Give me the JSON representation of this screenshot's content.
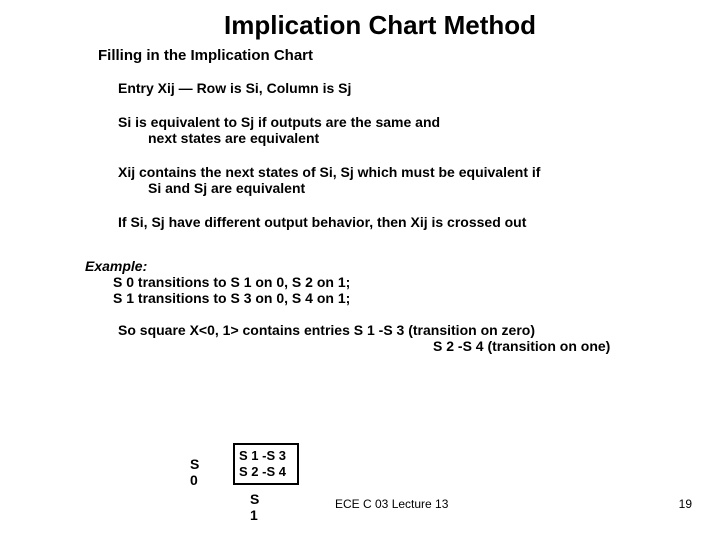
{
  "title": "Implication Chart Method",
  "subtitle": "Filling in the Implication Chart",
  "entry": "Entry Xij — Row is Si, Column is Sj",
  "para1_line1": "Si is equivalent to Sj if outputs are the same and",
  "para1_line2": "next states are equivalent",
  "para2_line1": "Xij contains the next states of Si, Sj which must be equivalent if",
  "para2_line2": "Si and Sj are equivalent",
  "para3": "If Si, Sj have different output behavior, then Xij is crossed out",
  "example_head": "Example:",
  "example_l1": "S 0 transitions to S 1 on 0, S 2 on 1;",
  "example_l2": "S 1 transitions to S 3 on 0, S 4 on 1;",
  "so_line1": "So square X<0, 1> contains entries S 1 -S 3 (transition on zero)",
  "so_line2": "S 2 -S 4 (transition on one)",
  "s0": "S 0",
  "box_l1": "S 1 -S 3",
  "box_l2": "S 2 -S 4",
  "s1": "S 1",
  "footer_lecture": "ECE C 03 Lecture 13",
  "footer_page": "19"
}
